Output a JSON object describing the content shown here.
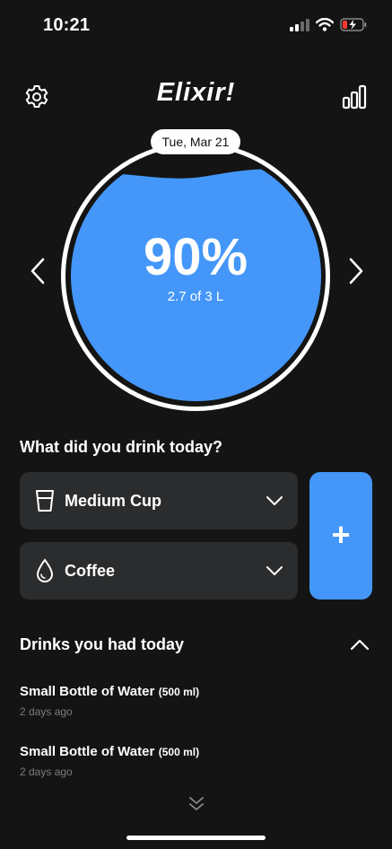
{
  "status_bar": {
    "time": "10:21"
  },
  "header": {
    "title": "Elixir!"
  },
  "progress": {
    "date": "Tue, Mar 21",
    "percent_label": "90%",
    "amount_label": "2.7 of 3 L",
    "fill_fraction": 0.9
  },
  "drink_picker": {
    "question": "What did you drink today?",
    "size": {
      "label": "Medium Cup",
      "icon": "cup-icon"
    },
    "type": {
      "label": "Coffee",
      "icon": "drop-icon"
    },
    "add_label": "+"
  },
  "history": {
    "title": "Drinks you had today",
    "entries": [
      {
        "name": "Small Bottle of Water",
        "volume": "(500 ml)",
        "time": "2 days ago"
      },
      {
        "name": "Small Bottle of Water",
        "volume": "(500 ml)",
        "time": "2 days ago"
      }
    ]
  },
  "colors": {
    "background": "#141414",
    "accent": "#4497f8",
    "card": "#2b2c2d",
    "muted": "#7d7d7d"
  }
}
